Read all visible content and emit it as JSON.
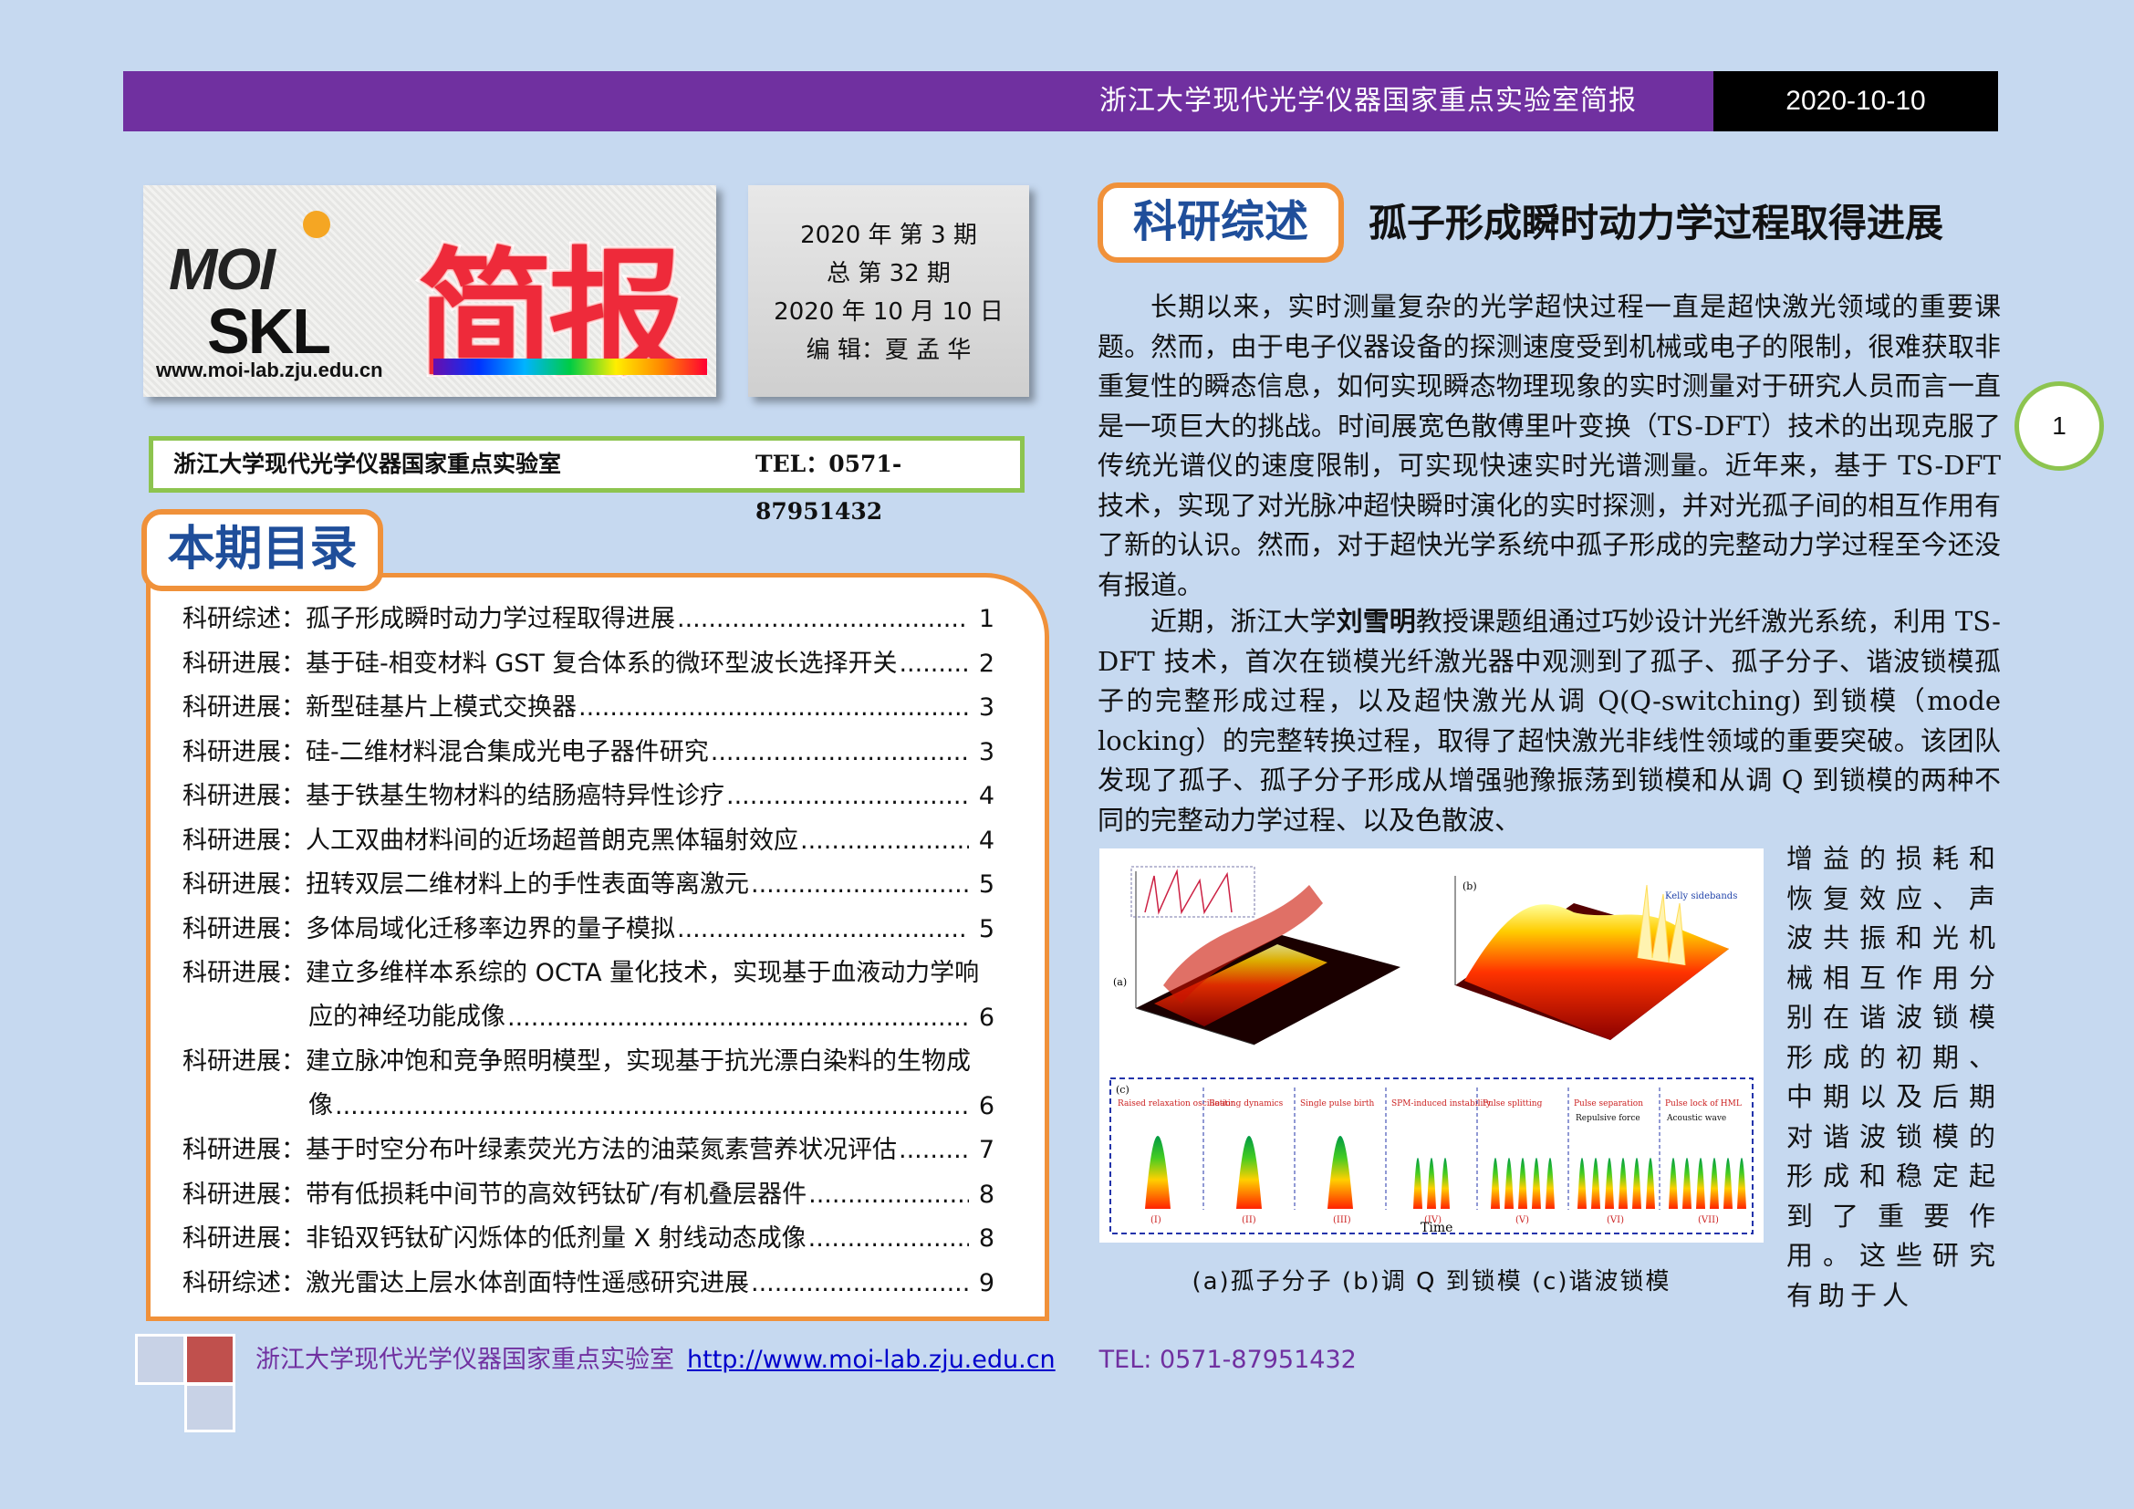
{
  "header": {
    "title": "浙江大学现代光学仪器国家重点实验室简报",
    "date": "2020-10-10"
  },
  "logo": {
    "moi": "MOI",
    "skl": "SKL",
    "jianbao": "简报",
    "url": "www.moi-lab.zju.edu.cn"
  },
  "issue": {
    "line1": "2020 年 第 3  期",
    "line2": "总 第 32 期",
    "line3": "2020 年 10 月 10 日",
    "line4": "编 辑：夏 孟 华"
  },
  "lab": {
    "name": "浙江大学现代光学仪器国家重点实验室",
    "tel": "TEL：0571-87951432"
  },
  "toc": {
    "heading": "本期目录",
    "items": [
      {
        "label": "科研综述：孤子形成瞬时动力学过程取得进展",
        "page": "1"
      },
      {
        "label": "科研进展：基于硅-相变材料 GST 复合体系的微环型波长选择开关",
        "page": "2"
      },
      {
        "label": "科研进展：新型硅基片上模式交换器",
        "page": "3"
      },
      {
        "label": "科研进展：硅-二维材料混合集成光电子器件研究",
        "page": "3"
      },
      {
        "label": "科研进展：基于铁基生物材料的结肠癌特异性诊疗 ",
        "page": "4"
      },
      {
        "label": "科研进展：人工双曲材料间的近场超普朗克黑体辐射效应",
        "page": "4"
      },
      {
        "label": "科研进展：扭转双层二维材料上的手性表面等离激元",
        "page": "5"
      },
      {
        "label": "科研进展：多体局域化迁移率边界的量子模拟",
        "page": "5"
      },
      {
        "label": "科研进展：建立多维样本系综的 OCTA 量化技术，实现基于血液动力学响",
        "cont": "应的神经功能成像",
        "page": "6"
      },
      {
        "label": "科研进展：建立脉冲饱和竞争照明模型，实现基于抗光漂白染料的生物成",
        "cont": "像",
        "page": "6"
      },
      {
        "label": "科研进展：基于时空分布叶绿素荧光方法的油菜氮素营养状况评估",
        "page": "7"
      },
      {
        "label": "科研进展：带有低损耗中间节的高效钙钛矿/有机叠层器件",
        "page": "8"
      },
      {
        "label": "科研进展：非铅双钙钛矿闪烁体的低剂量 X 射线动态成像",
        "page": "8"
      },
      {
        "label": "科研综述：激光雷达上层水体剖面特性遥感研究进展",
        "page": "9"
      }
    ]
  },
  "article": {
    "tab": "科研综述",
    "title": "孤子形成瞬时动力学过程取得进展",
    "para1": "长期以来，实时测量复杂的光学超快过程一直是超快激光领域的重要课题。然而，由于电子仪器设备的探测速度受到机械或电子的限制，很难获取非重复性的瞬态信息，如何实现瞬态物理现象的实时测量对于研究人员而言一直是一项巨大的挑战。时间展宽色散傅里叶变换（TS-DFT）技术的出现克服了传统光谱仪的速度限制，可实现快速实时光谱测量。近年来，基于 TS-DFT 技术，实现了对光脉冲超快瞬时演化的实时探测，并对光孤子间的相互作用有了新的认识。然而，对于超快光学系统中孤子形成的完整动力学过程至今还没有报道。",
    "para2_a": "近期，浙江大学",
    "para2_name": "刘雪明",
    "para2_b": "教授课题组通过巧妙设计光纤激光系统，利用 TS-DFT 技术，首次在锁模光纤激光器中观测到了孤子、孤子分子、谐波锁模孤子的完整形成过程，以及超快激光从调 Q(Q-switching) 到锁模（mode locking）的完整转换过程，取得了超快激光非线性领域的重要突破。该团队发现了孤子、孤子分子形成从增强驰豫振荡到锁模和从调 Q 到锁模的两种不同的完整动力学过程、以及色散波、",
    "para3": "增益的损耗和恢复效应、声波共振和光机械相互作用分别在谐波锁模形成的初期、中期以及后期对谐波锁模的形成和稳定起到了重要作用。这些研究有助于人",
    "page_number": "1",
    "figure": {
      "caption": "(a)孤子分子 (b)调 Q 到锁模 (c)谐波锁模",
      "panel_a": "(a)",
      "panel_b": "(b)",
      "panel_c": "(c)",
      "labels_c": [
        "Raised relaxation oscillation",
        "Beating dynamics",
        "Single pulse birth",
        "SPM-induced instability",
        "Pulse splitting",
        "Pulse separation",
        "Pulse lock of HML"
      ],
      "sub_c": [
        "Repulsive force",
        "Acoustic wave"
      ],
      "stages_c": [
        "(I)",
        "(II)",
        "(III)",
        "(IV)",
        "(V)",
        "(VI)",
        "(VII)"
      ],
      "time_label": "Time",
      "kelly": "Kelly sidebands"
    }
  },
  "footer": {
    "lab": "浙江大学现代光学仪器国家重点实验室",
    "url": "http://www.moi-lab.zju.edu.cn",
    "tel": "TEL: 0571-87951432"
  },
  "colors": {
    "background": "#c6d9f0",
    "header": "#7030a0",
    "accent_orange": "#f0913a",
    "accent_green": "#8dc44f",
    "heading_blue": "#1f4e9a"
  }
}
